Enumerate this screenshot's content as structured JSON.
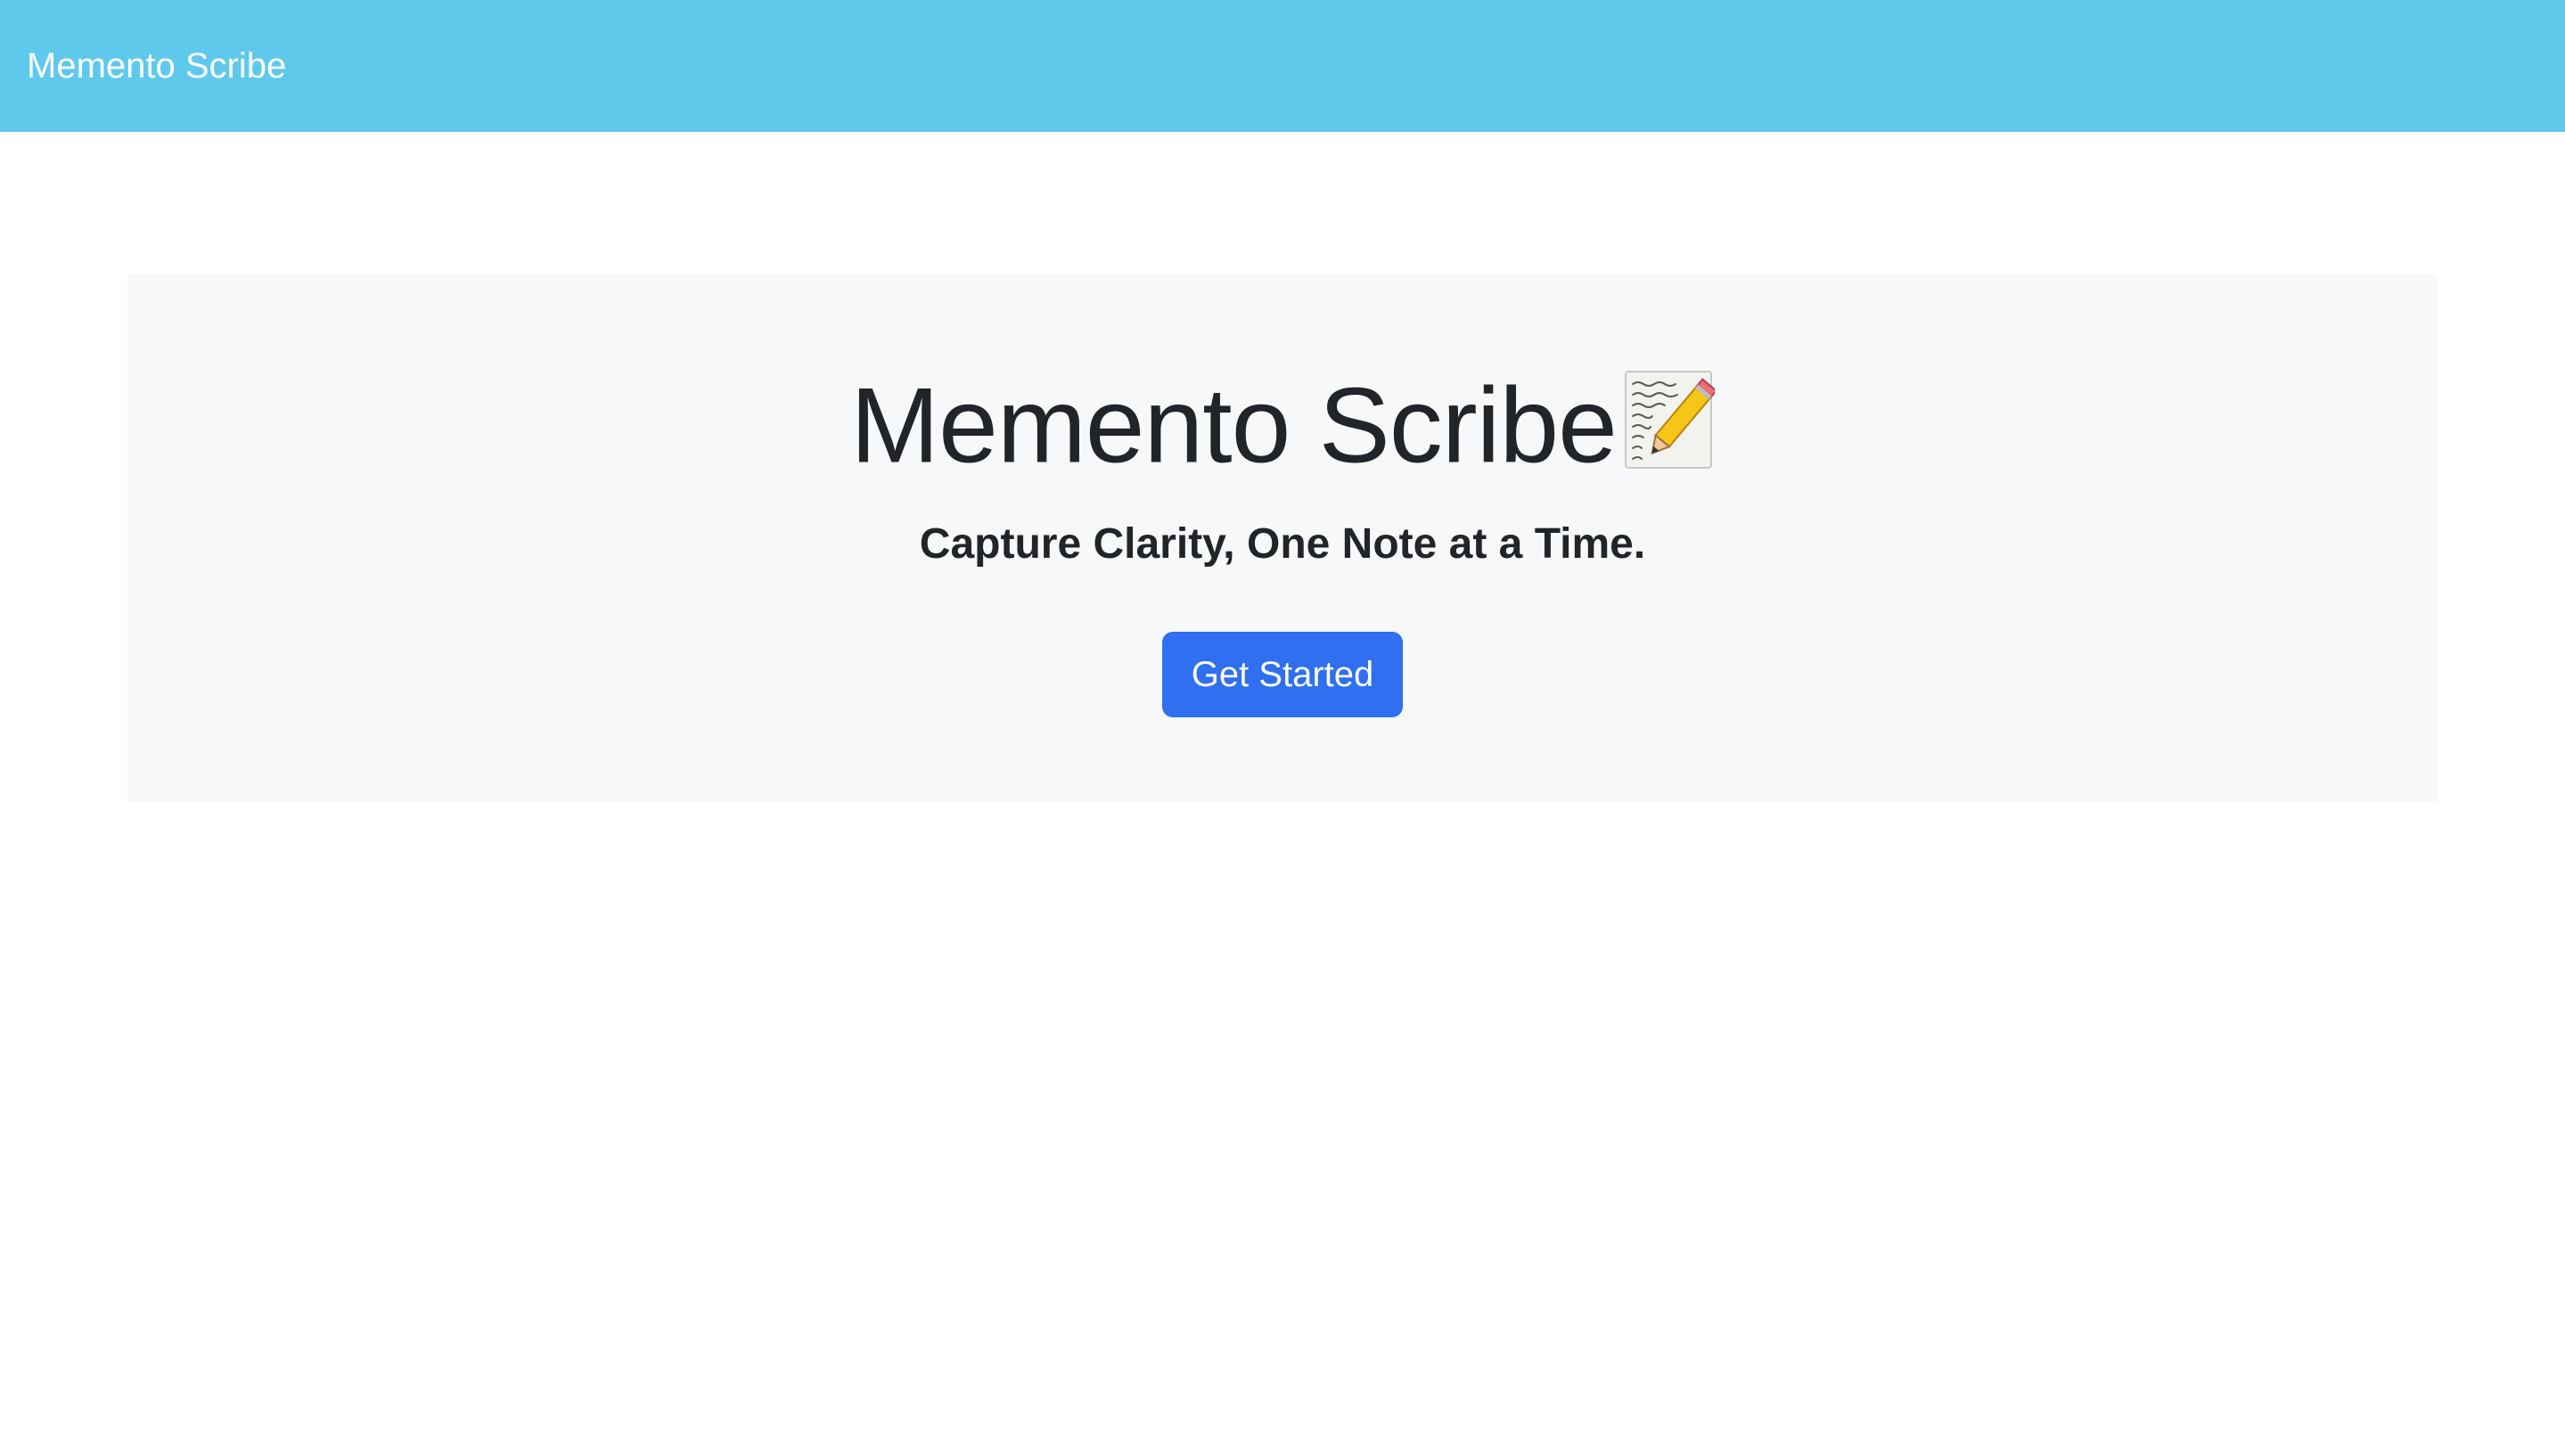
{
  "navbar": {
    "brand": "Memento Scribe",
    "background_color": "#5fc9ec"
  },
  "hero": {
    "title": "Memento Scribe",
    "title_icon": "memo-pencil-icon",
    "subtitle": "Capture Clarity, One Note at a Time.",
    "cta_label": "Get Started",
    "background_color": "#f7f8fa",
    "cta_color": "#2f6ff0"
  }
}
